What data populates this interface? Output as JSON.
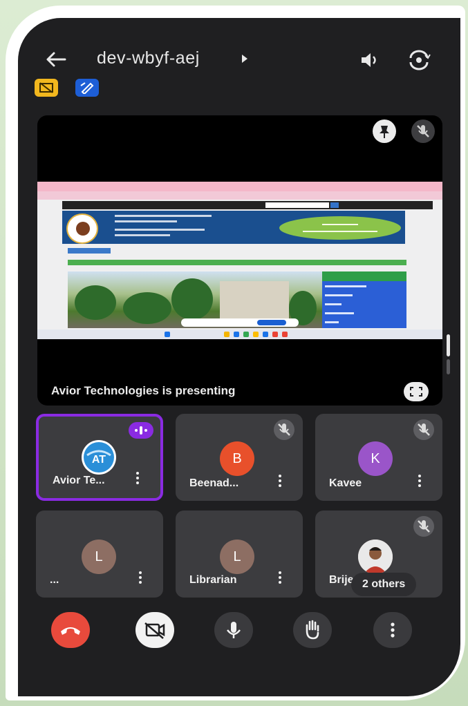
{
  "meeting": {
    "code": "dev-wbyf-aej"
  },
  "presentation": {
    "status_text": "Avior Technologies is presenting"
  },
  "participants": [
    {
      "name": "Avior Te...",
      "initial": "",
      "avatar_color": "#ffffff",
      "speaking": true,
      "muted": false
    },
    {
      "name": "Beenad...",
      "initial": "B",
      "avatar_color": "#e8502b",
      "speaking": false,
      "muted": true
    },
    {
      "name": "Kavee",
      "initial": "K",
      "avatar_color": "#9a55c9",
      "speaking": false,
      "muted": true
    },
    {
      "name": "...",
      "initial": "L",
      "avatar_color": "#8d6e63",
      "speaking": false,
      "muted": false
    },
    {
      "name": "Librarian",
      "initial": "L",
      "avatar_color": "#8d6e63",
      "speaking": false,
      "muted": false
    },
    {
      "name": "Brije",
      "initial": "",
      "avatar_color": "#c0392b",
      "speaking": false,
      "muted": true
    }
  ],
  "others_label": "2 others",
  "controls": [
    "end-call",
    "camera-off",
    "microphone",
    "raise-hand",
    "more-options"
  ],
  "colors": {
    "end_call": "#e84a3c",
    "speaking_border": "#8a2be2",
    "tile_bg": "#3c3c3f"
  }
}
